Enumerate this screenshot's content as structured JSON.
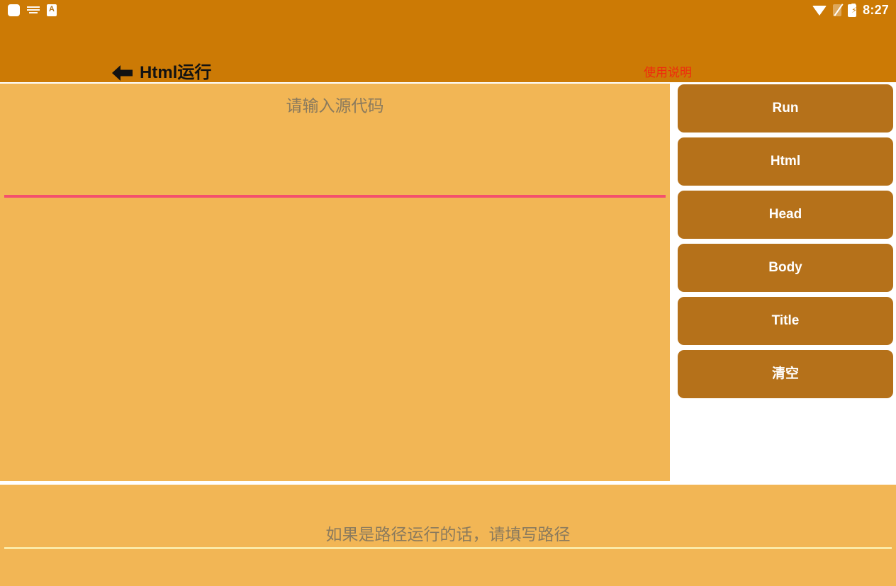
{
  "statusbar": {
    "time": "8:27",
    "left_icons": [
      {
        "name": "notification-app-icon",
        "glyph": ""
      },
      {
        "name": "keyboard-icon",
        "glyph": ""
      },
      {
        "name": "dictionary-a-icon",
        "glyph": "A"
      }
    ],
    "right_icons": [
      {
        "name": "wifi-icon"
      },
      {
        "name": "sim-card-off-icon"
      },
      {
        "name": "battery-charging-icon",
        "glyph": "⚡"
      }
    ]
  },
  "appbar": {
    "back_icon": "back-arrow-icon",
    "title": "Html运行",
    "help_label": "使用说明"
  },
  "source_editor": {
    "placeholder": "请输入源代码",
    "value": "",
    "underline_color": "#f4506e"
  },
  "buttons": [
    {
      "id": "run",
      "label": "Run"
    },
    {
      "id": "html",
      "label": "Html"
    },
    {
      "id": "head",
      "label": "Head"
    },
    {
      "id": "body",
      "label": "Body"
    },
    {
      "id": "title",
      "label": "Title"
    },
    {
      "id": "clear",
      "label": "清空"
    }
  ],
  "path_input": {
    "placeholder": "如果是路径运行的话，请填写路径",
    "value": ""
  },
  "colors": {
    "appbar": "#cc7a05",
    "body": "#f2b655",
    "button": "#b5711a",
    "accent_underline": "#f4506e",
    "help_text": "#ef2a0e",
    "divider": "#ffffff"
  }
}
